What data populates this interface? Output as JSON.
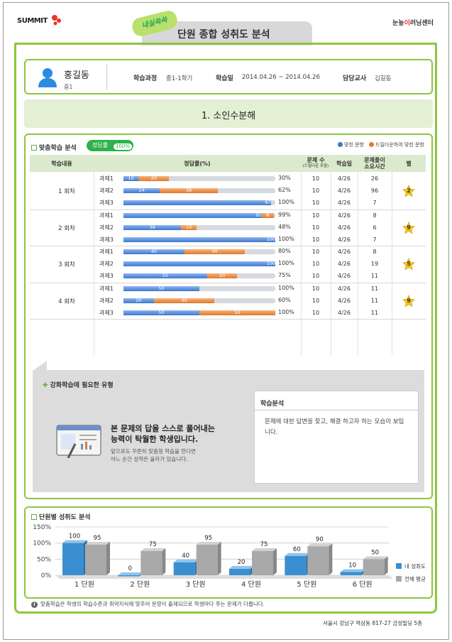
{
  "header": {
    "brand_left": "SUMMIT",
    "brand_right_a": "눈높",
    "brand_right_b": "이",
    "brand_right_c": "러닝센터",
    "badge": "내실쏙쏙",
    "title": "단원 종합 성취도 분석"
  },
  "student": {
    "name": "홍길동",
    "grade": "중1",
    "course_label": "학습과정",
    "course_value": "중1-1학기",
    "date_label": "학습일",
    "date_value": "2014.04.26 ~ 2014.04.26",
    "teacher_label": "담당교사",
    "teacher_value": "김길동"
  },
  "unit_title": "1. 소인수분해",
  "custom": {
    "title": "맞춤학습 분석",
    "pill_label": "정답률",
    "pill_value": "100%",
    "legend_blue": "맞힌 문항",
    "legend_orange": "드릴다운하여 맞힌 문항",
    "colors": {
      "blue": "#3c78d2",
      "orange": "#e07a2e",
      "green": "#8cc63f"
    },
    "headers": {
      "content": "학습내용",
      "rate": "정답률(%)",
      "count": "문제 수",
      "count_sub": "(드릴다운 포함)",
      "date": "학습일",
      "time_a": "문제풀이",
      "time_b": "소요시간",
      "star": "별"
    },
    "sessions": [
      {
        "label": "1 회차",
        "stars": "2",
        "rows": [
          {
            "name": "과제1",
            "blue": "10",
            "orange": "20",
            "pct": "30%",
            "count": "10",
            "date": "4/26",
            "time": "26"
          },
          {
            "name": "과제2",
            "blue": "24",
            "orange": "38",
            "pct": "62%",
            "count": "10",
            "date": "4/26",
            "time": "96"
          },
          {
            "name": "과제3",
            "blue": "97",
            "orange": "",
            "pct": "100%",
            "count": "10",
            "date": "4/26",
            "time": "7"
          }
        ]
      },
      {
        "label": "2 회차",
        "stars": "9",
        "rows": [
          {
            "name": "과제1",
            "blue": "91",
            "orange": "8",
            "pct": "99%",
            "count": "10",
            "date": "4/26",
            "time": "8"
          },
          {
            "name": "과제2",
            "blue": "38",
            "orange": "10",
            "pct": "48%",
            "count": "10",
            "date": "4/26",
            "time": "6"
          },
          {
            "name": "과제3",
            "blue": "100",
            "orange": "",
            "pct": "100%",
            "count": "10",
            "date": "4/26",
            "time": "7"
          }
        ]
      },
      {
        "label": "3 회차",
        "stars": "5",
        "rows": [
          {
            "name": "과제1",
            "blue": "40",
            "orange": "40",
            "pct": "80%",
            "count": "10",
            "date": "4/26",
            "time": "8"
          },
          {
            "name": "과제2",
            "blue": "100",
            "orange": "",
            "pct": "100%",
            "count": "10",
            "date": "4/26",
            "time": "19"
          },
          {
            "name": "과제3",
            "blue": "55",
            "orange": "20",
            "pct": "75%",
            "count": "10",
            "date": "4/26",
            "time": "11"
          }
        ]
      },
      {
        "label": "4 회차",
        "stars": "9",
        "rows": [
          {
            "name": "과제1",
            "blue": "50",
            "orange": "",
            "pct": "100%",
            "count": "10",
            "date": "4/26",
            "time": "11"
          },
          {
            "name": "과제2",
            "blue": "20",
            "orange": "40",
            "pct": "60%",
            "count": "10",
            "date": "4/26",
            "time": "11"
          },
          {
            "name": "과제3",
            "blue": "50",
            "orange": "50",
            "pct": "100%",
            "count": "10",
            "date": "4/26",
            "time": "11"
          }
        ]
      }
    ]
  },
  "reinforce": {
    "title": "강화학습에 필요한 유형",
    "msg_line1": "본 문제의 답을 스스로 풀어내는",
    "msg_line2": "능력이 탁월한 학생입니다.",
    "sub_line1": "앞으로도 꾸준히 맞춤형 학습을 한다면",
    "sub_line2": "어느 순간 성적은 올라가 있습니다.",
    "analysis_title": "학습분석",
    "analysis_text": "문제에 대한 답변을 찾고, 해결 하고자 하는 모습이 보입니다."
  },
  "chart_data": {
    "type": "bar",
    "title": "단원별 성취도 분석",
    "categories": [
      "1 단원",
      "2 단원",
      "3 단원",
      "4 단원",
      "5 단원",
      "6 단원"
    ],
    "series": [
      {
        "name": "내 성취도",
        "values": [
          100,
          0,
          40,
          20,
          60,
          10
        ],
        "color": "#3a8fd0"
      },
      {
        "name": "전체 평균",
        "values": [
          95,
          75,
          95,
          75,
          90,
          50
        ],
        "color": "#a9a9a9"
      }
    ],
    "ylim": [
      0,
      150
    ],
    "yticks": [
      "0%",
      "50%",
      "100%",
      "150%"
    ],
    "grid": true,
    "legend": "right"
  },
  "footer": {
    "note": "맞춤학습은 학생의 학습수준과 취약지식에 맞추어 문항이 출제되므로 학생마다 푸는 문제가 다릅니다.",
    "note_icon": "i",
    "address": "서울시 강남구 역삼동 817-27 금성빌딩 5층"
  }
}
